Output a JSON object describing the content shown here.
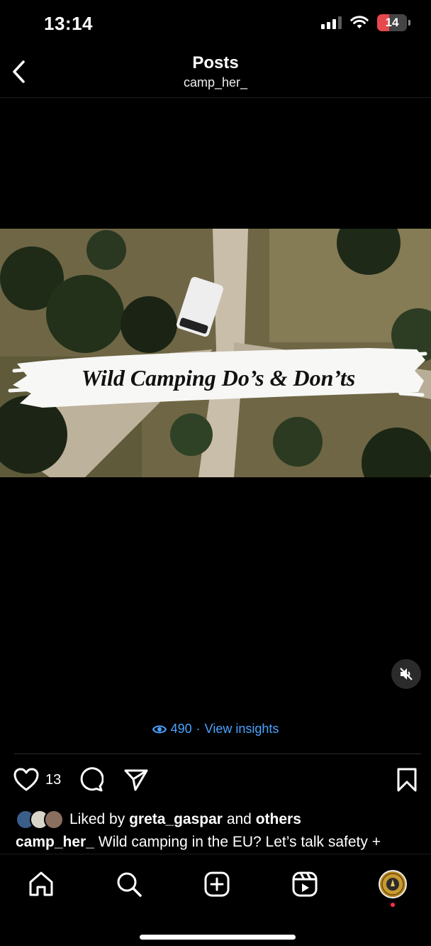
{
  "status_bar": {
    "time": "13:14",
    "battery": "14",
    "battery_level": 0.14
  },
  "header": {
    "title": "Posts",
    "username": "camp_her_"
  },
  "video": {
    "overlay_title": "Wild Camping Do’s & Don’ts",
    "muted": true
  },
  "insights": {
    "views": "490",
    "separator": "·",
    "link": "View insights"
  },
  "actions": {
    "like_count": "13"
  },
  "liked_by": {
    "prefix": "Liked by",
    "user": "greta_gaspar",
    "middle": "and",
    "others": "others"
  },
  "caption": {
    "username": "camp_her_",
    "text": "Wild camping in the EU? Let’s talk safety +"
  },
  "nav": [
    "home-icon",
    "search-icon",
    "create-icon",
    "reels-icon",
    "profile-avatar"
  ],
  "colors": {
    "link": "#4aa3ff",
    "battery": "#e5484d",
    "notification_dot": "#ff2d47"
  }
}
